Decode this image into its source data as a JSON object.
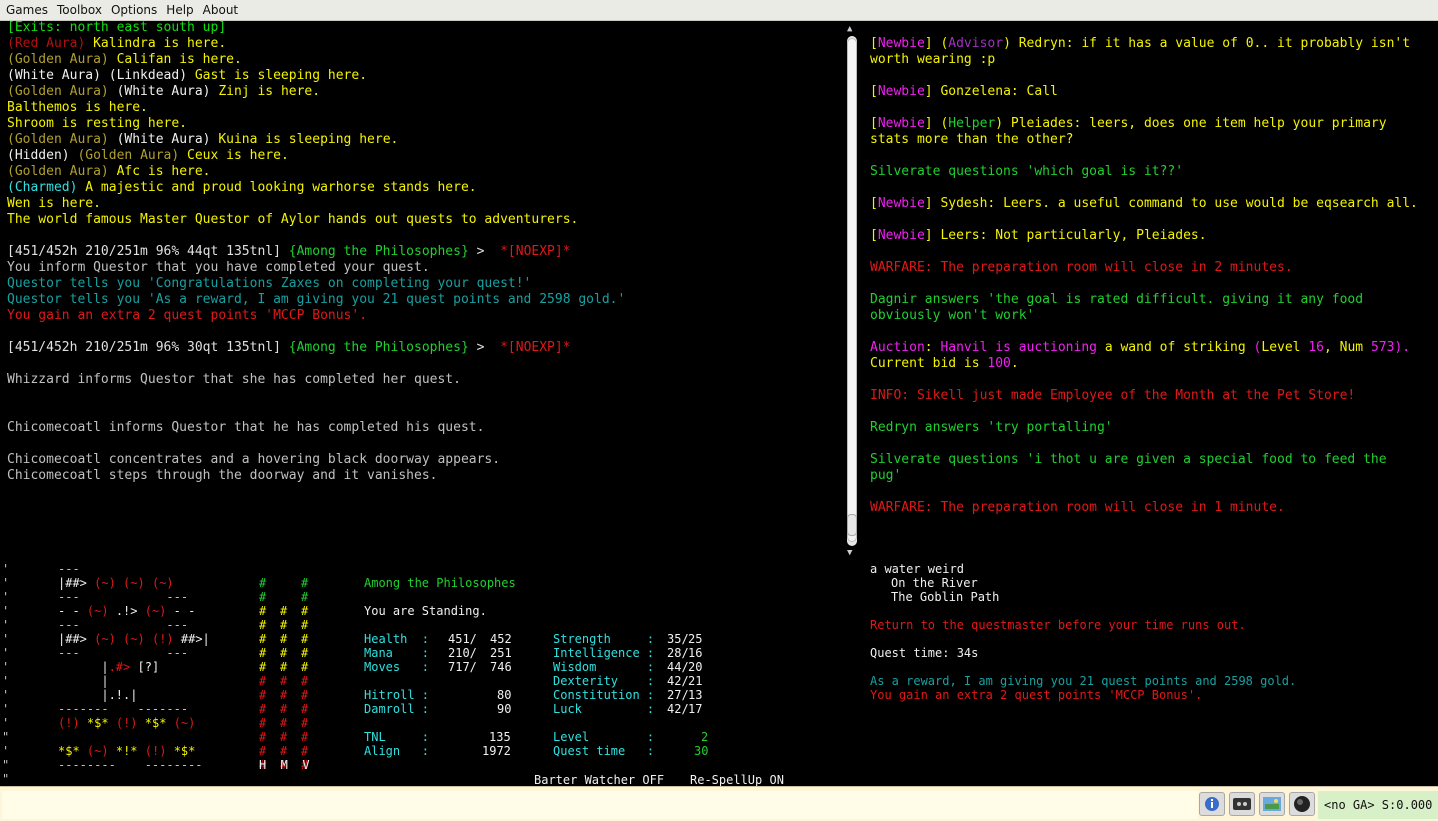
{
  "menu": [
    "Games",
    "Toolbox",
    "Options",
    "Help",
    "About"
  ],
  "main": {
    "exits": "[Exits: north east south up]",
    "room": [
      [
        [
          "(Red Aura) ",
          "dred"
        ],
        [
          "Kalindra is here.",
          "yel"
        ]
      ],
      [
        [
          "(Golden Aura) ",
          "gold"
        ],
        [
          "Califan is here.",
          "yel"
        ]
      ],
      [
        [
          "(White Aura) ",
          "wht"
        ],
        [
          "(Linkdead) ",
          "wht"
        ],
        [
          "Gast is sleeping here.",
          "yel"
        ]
      ],
      [
        [
          "(Golden Aura) ",
          "gold"
        ],
        [
          "(White Aura) ",
          "wht"
        ],
        [
          "Zinj is here.",
          "yel"
        ]
      ],
      [
        [
          "Balthemos is here.",
          "yel"
        ]
      ],
      [
        [
          "Shroom is resting here.",
          "yel"
        ]
      ],
      [
        [
          "(Golden Aura) ",
          "gold"
        ],
        [
          "(White Aura) ",
          "wht"
        ],
        [
          "Kuina is sleeping here.",
          "yel"
        ]
      ],
      [
        [
          "(Hidden) ",
          "wht"
        ],
        [
          "(Golden Aura) ",
          "gold"
        ],
        [
          "Ceux is here.",
          "yel"
        ]
      ],
      [
        [
          "(Golden Aura) ",
          "gold"
        ],
        [
          "Afc is here.",
          "yel"
        ]
      ],
      [
        [
          "(Charmed) ",
          "cyn"
        ],
        [
          "A majestic and proud looking warhorse stands here.",
          "yel"
        ]
      ],
      [
        [
          "Wen is here.",
          "yel"
        ]
      ],
      [
        [
          "The world famous Master Questor of Aylor hands out quests to adventurers.",
          "yel"
        ]
      ]
    ],
    "prompt1": [
      [
        "[451/452h 210/251m 96% 44qt 135tnl] ",
        "hp"
      ],
      [
        "{Among the Philosophes}",
        "grn"
      ],
      [
        " > ",
        "hp"
      ],
      [
        " *[NOEXP]*",
        "red"
      ]
    ],
    "quest": [
      [
        [
          "You inform Questor that you have completed your quest.",
          "gry"
        ]
      ],
      [
        [
          "Questor tells you 'Congratulations Zaxes on completing your quest!'",
          "tel"
        ]
      ],
      [
        [
          "Questor tells you 'As a reward, I am giving you 21 quest points and 2598 gold.'",
          "tel"
        ]
      ],
      [
        [
          "You gain an extra 2 quest points 'MCCP Bonus'.",
          "red"
        ]
      ]
    ],
    "prompt2": [
      [
        "[451/452h 210/251m 96% 30qt 135tnl] ",
        "hp"
      ],
      [
        "{Among the Philosophes}",
        "grn"
      ],
      [
        " > ",
        "hp"
      ],
      [
        " *[NOEXP]*",
        "red"
      ]
    ],
    "whizzard": "Whizzard informs Questor that she has completed her quest.",
    "chico1": "Chicomecoatl informs Questor that he has completed his quest.",
    "chico2": "Chicomecoatl concentrates and a hovering black doorway appears.",
    "chico3": "Chicomecoatl steps through the doorway and it vanishes."
  },
  "channels": {
    "lines": [
      [
        [
          "[",
          "yel"
        ],
        [
          "Newbie",
          "mag"
        ],
        [
          "] (",
          "yel"
        ],
        [
          "Advisor",
          "pur"
        ],
        [
          ") Redryn: if it has a value of 0.. it probably isn't",
          "yel"
        ]
      ],
      [
        [
          "worth wearing :p",
          "yel"
        ]
      ],
      [],
      [
        [
          "[",
          "yel"
        ],
        [
          "Newbie",
          "mag"
        ],
        [
          "] Gonzelena: Call",
          "yel"
        ]
      ],
      [],
      [
        [
          "[",
          "yel"
        ],
        [
          "Newbie",
          "mag"
        ],
        [
          "] (",
          "yel"
        ],
        [
          "Helper",
          "grn"
        ],
        [
          ") Pleiades: leers, does one item help your primary",
          "yel"
        ]
      ],
      [
        [
          "stats more than the other?",
          "yel"
        ]
      ],
      [],
      [
        [
          "Silverate questions 'which goal is it??'",
          "grn"
        ]
      ],
      [],
      [
        [
          "[",
          "yel"
        ],
        [
          "Newbie",
          "mag"
        ],
        [
          "] Sydesh: Leers. a useful command to use would be eqsearch all.",
          "yel"
        ]
      ],
      [],
      [
        [
          "[",
          "yel"
        ],
        [
          "Newbie",
          "mag"
        ],
        [
          "] Leers: Not particularly, Pleiades.",
          "yel"
        ]
      ],
      [],
      [
        [
          "WARFARE: The preparation room will close in 2 minutes.",
          "red"
        ]
      ],
      [],
      [
        [
          "Dagnir answers 'the goal is rated difficult. giving it any food",
          "grn"
        ]
      ],
      [
        [
          "obviously won't work'",
          "grn"
        ]
      ],
      [],
      [
        [
          "Auction",
          "mag"
        ],
        [
          ": ",
          "yel"
        ],
        [
          "Hanvil is auctioning ",
          "mag"
        ],
        [
          "a wand of striking ",
          "yel"
        ],
        [
          "(",
          "mag"
        ],
        [
          "Level ",
          "yel"
        ],
        [
          "16",
          "mag"
        ],
        [
          ", ",
          "yel"
        ],
        [
          "Num ",
          "yel"
        ],
        [
          "573",
          "mag"
        ],
        [
          ").",
          "mag"
        ]
      ],
      [
        [
          "Current bid is ",
          "yel"
        ],
        [
          "100",
          "mag"
        ],
        [
          ".",
          "yel"
        ]
      ],
      [],
      [
        [
          "INFO: Sikell just made Employee of the Month at the Pet Store!",
          "red"
        ]
      ],
      [],
      [
        [
          "Redryn answers 'try portalling'",
          "grn"
        ]
      ],
      [],
      [
        [
          "Silverate questions 'i thot u are given a special food to feed the",
          "grn"
        ]
      ],
      [
        [
          "pug'",
          "grn"
        ]
      ],
      [],
      [
        [
          "WARFARE: The preparation room will close in 1 minute.",
          "red"
        ]
      ]
    ]
  },
  "quest_panel": {
    "target": "a water weird",
    "area1": "On the River",
    "area2": "The Goblin Path",
    "instruction": "Return to the questmaster before your time runs out.",
    "time": "Quest time: 34s",
    "reward": "As a reward, I am giving you 21 quest points and 2598 gold.",
    "bonus": "You gain an extra 2 quest points 'MCCP Bonus'."
  },
  "map": {
    "left_ticks": [
      "'",
      "'",
      "'",
      "'",
      "'",
      "'",
      "'",
      "'",
      "'",
      "'",
      "'",
      "'",
      "\"",
      "'",
      "\"",
      "\""
    ],
    "rows": [
      [
        [
          "---",
          "gry"
        ]
      ],
      [
        [
          "|##> ",
          "wht"
        ],
        [
          "(~)",
          "red"
        ],
        [
          " ",
          "wht"
        ],
        [
          "(~)",
          "red"
        ],
        [
          " ",
          "wht"
        ],
        [
          "(~)",
          "red"
        ]
      ],
      [
        [
          "---",
          "gry"
        ],
        [
          "            ",
          "gry"
        ],
        [
          "---",
          "gry"
        ]
      ],
      [
        [
          "- - ",
          "wht"
        ],
        [
          "(~)",
          "red"
        ],
        [
          " .!> ",
          "wht"
        ],
        [
          "(~)",
          "red"
        ],
        [
          " - -",
          "wht"
        ]
      ],
      [
        [
          "---",
          "gry"
        ],
        [
          "            ",
          "gry"
        ],
        [
          "---",
          "gry"
        ]
      ],
      [
        [
          "|##> ",
          "wht"
        ],
        [
          "(~)",
          "red"
        ],
        [
          " ",
          "wht"
        ],
        [
          "(~)",
          "red"
        ],
        [
          " ",
          "wht"
        ],
        [
          "(!)",
          "red"
        ],
        [
          " ##>|",
          "wht"
        ]
      ],
      [
        [
          "---",
          "gry"
        ],
        [
          "            ",
          "gry"
        ],
        [
          "---",
          "gry"
        ]
      ],
      [
        [
          "      |",
          "wht"
        ],
        [
          ".#>",
          "red"
        ],
        [
          " [?]",
          "wht"
        ]
      ],
      [
        [
          "      |",
          "wht"
        ]
      ],
      [
        [
          "      |.!.|",
          "wht"
        ]
      ],
      [
        [
          "-------    -------",
          "gry"
        ]
      ],
      [
        [
          "(!)",
          "red"
        ],
        [
          " ",
          "wht"
        ],
        [
          "*$*",
          "yel"
        ],
        [
          " ",
          "wht"
        ],
        [
          "(!)",
          "red"
        ],
        [
          " ",
          "wht"
        ],
        [
          "*$*",
          "yel"
        ],
        [
          " ",
          "wht"
        ],
        [
          "(~)",
          "red"
        ]
      ],
      [],
      [
        [
          "*$*",
          "yel"
        ],
        [
          " ",
          "wht"
        ],
        [
          "(~)",
          "red"
        ],
        [
          " ",
          "wht"
        ],
        [
          "*!*",
          "yel"
        ],
        [
          " ",
          "wht"
        ],
        [
          "(!)",
          "red"
        ],
        [
          " ",
          "wht"
        ],
        [
          "*$*",
          "yel"
        ]
      ],
      [
        [
          "--------    --------",
          "gry"
        ]
      ]
    ],
    "hmv_colors": [
      "grn",
      "grn",
      "yel",
      "yel",
      "yel",
      "yel",
      "yel",
      "red",
      "red",
      "red",
      "red",
      "red",
      "red",
      "red"
    ],
    "hmv_rows": [
      [
        "#",
        "",
        "#"
      ],
      [
        "#",
        "",
        "#"
      ],
      [
        "#",
        "#",
        "#"
      ],
      [
        "#",
        "#",
        "#"
      ],
      [
        "#",
        "#",
        "#"
      ],
      [
        "#",
        "#",
        "#"
      ],
      [
        "#",
        "#",
        "#"
      ],
      [
        "#",
        "#",
        "#"
      ],
      [
        "#",
        "#",
        "#"
      ],
      [
        "#",
        "#",
        "#"
      ],
      [
        "#",
        "#",
        "#"
      ],
      [
        "#",
        "#",
        "#"
      ],
      [
        "#",
        "#",
        "#"
      ],
      [
        "#",
        "#",
        "#"
      ]
    ],
    "hmv_label": "H  M  V"
  },
  "stats": {
    "location": "Among the Philosophes",
    "position": "You are Standing.",
    "left": [
      {
        "label": "Health  :",
        "cur": "451/",
        "max": "452"
      },
      {
        "label": "Mana    :",
        "cur": "210/",
        "max": "251"
      },
      {
        "label": "Moves   :",
        "cur": "717/",
        "max": "746"
      }
    ],
    "right": [
      {
        "label": "Strength     :",
        "cur": "35/",
        "max": "25"
      },
      {
        "label": "Intelligence :",
        "cur": "28/",
        "max": "16"
      },
      {
        "label": "Wisdom       :",
        "cur": "44/",
        "max": "20"
      },
      {
        "label": "Dexterity    :",
        "cur": "42/",
        "max": "21"
      },
      {
        "label": "Constitution :",
        "cur": "27/",
        "max": "13"
      },
      {
        "label": "Luck         :",
        "cur": "42/",
        "max": "17"
      }
    ],
    "hitroll_label": "Hitroll :",
    "hitroll": "80",
    "damroll_label": "Damroll :",
    "damroll": "90",
    "tnl_label": "TNL     :",
    "tnl": "135",
    "align_label": "Align   :",
    "align": "1972",
    "level_label": "Level        :",
    "level": "2",
    "qtime_label": "Quest time   :",
    "qtime": "30"
  },
  "footer": {
    "barter": "Barter Watcher OFF",
    "respell": "Re-SpellUp ON"
  },
  "statusbar": {
    "ga": "<no GA> S:0.000"
  }
}
